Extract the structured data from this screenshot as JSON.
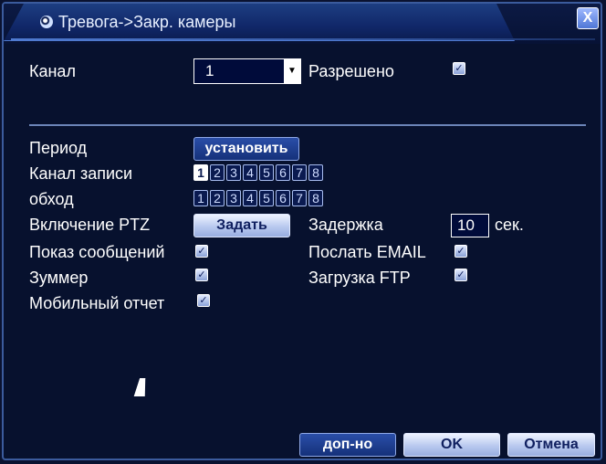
{
  "window": {
    "title": "Тревога->Закр. камеры",
    "close_label": "X"
  },
  "form": {
    "channel_label": "Канал",
    "channel_value": "1",
    "enabled_label": "Разрешено",
    "period_label": "Период",
    "period_button": "установить",
    "record_channel_label": "Канал записи",
    "tour_label": "обход",
    "channels": [
      "1",
      "2",
      "3",
      "4",
      "5",
      "6",
      "7",
      "8"
    ],
    "ptz_label": "Включение PTZ",
    "ptz_button": "Задать",
    "delay_label": "Задержка",
    "delay_value": "10",
    "delay_unit": "сек.",
    "show_message_label": "Показ сообщений",
    "send_email_label": "Послать EMAIL",
    "buzzer_label": "Зуммер",
    "ftp_label": "Загрузка FTP",
    "mobile_report_label": "Мобильный отчет",
    "check_mark": "✓"
  },
  "footer": {
    "advanced_button": "доп-но",
    "ok_button": "OK",
    "cancel_button": "Отмена"
  },
  "colors": {
    "background": "#07112e",
    "accent": "#1d3e82",
    "border": "#3b5b9d"
  }
}
